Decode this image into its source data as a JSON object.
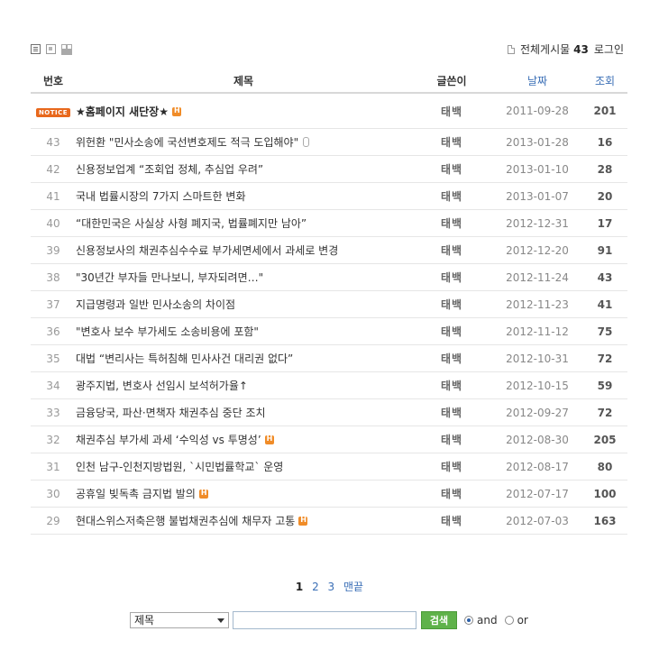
{
  "top": {
    "total_label": "전체게시물",
    "total_count": "43",
    "login": "로그인"
  },
  "headers": {
    "no": "번호",
    "title": "제목",
    "author": "글쓴이",
    "date": "날짜",
    "views": "조회"
  },
  "notice": {
    "badge": "NOTICE",
    "title": "★홈페이지 새단장★",
    "author": "태백",
    "date": "2011-09-28",
    "views": "201"
  },
  "rows": [
    {
      "no": "43",
      "title": "위헌환 \"민사소송에 국선변호제도 적극 도입해야\"",
      "author": "태백",
      "date": "2013-01-28",
      "views": "16"
    },
    {
      "no": "42",
      "title": "신용정보업계 “조회업 정체, 추심업 우려”",
      "author": "태백",
      "date": "2013-01-10",
      "views": "28"
    },
    {
      "no": "41",
      "title": "국내 법률시장의 7가지 스마트한 변화",
      "author": "태백",
      "date": "2013-01-07",
      "views": "20"
    },
    {
      "no": "40",
      "title": "“대한민국은 사실상 사형 폐지국, 법률폐지만 남아”",
      "author": "태백",
      "date": "2012-12-31",
      "views": "17"
    },
    {
      "no": "39",
      "title": "신용정보사의 채권추심수수료 부가세면세에서 과세로 변경",
      "author": "태백",
      "date": "2012-12-20",
      "views": "91"
    },
    {
      "no": "38",
      "title": "\"30년간 부자들 만나보니, 부자되려면…\"",
      "author": "태백",
      "date": "2012-11-24",
      "views": "43"
    },
    {
      "no": "37",
      "title": "지급명령과 일반 민사소송의 차이점",
      "author": "태백",
      "date": "2012-11-23",
      "views": "41"
    },
    {
      "no": "36",
      "title": "\"변호사 보수 부가세도 소송비용에 포함\"",
      "author": "태백",
      "date": "2012-11-12",
      "views": "75"
    },
    {
      "no": "35",
      "title": "대법 “변리사는 특허침해 민사사건 대리권 없다”",
      "author": "태백",
      "date": "2012-10-31",
      "views": "72"
    },
    {
      "no": "34",
      "title": "광주지법, 변호사 선임시 보석허가율↑",
      "author": "태백",
      "date": "2012-10-15",
      "views": "59"
    },
    {
      "no": "33",
      "title": "금융당국, 파산·면책자 채권추심 중단 조치",
      "author": "태백",
      "date": "2012-09-27",
      "views": "72"
    },
    {
      "no": "32",
      "title": "채권추심 부가세 과세 ‘수익성 vs 투명성’",
      "author": "태백",
      "date": "2012-08-30",
      "views": "205"
    },
    {
      "no": "31",
      "title": "인천 남구-인천지방법원, `시민법률학교` 운영",
      "author": "태백",
      "date": "2012-08-17",
      "views": "80"
    },
    {
      "no": "30",
      "title": "공휴일 빚독촉 금지법 발의",
      "author": "태백",
      "date": "2012-07-17",
      "views": "100"
    },
    {
      "no": "29",
      "title": "현대스위스저축은행 불법채권추심에 채무자 고통",
      "author": "태백",
      "date": "2012-07-03",
      "views": "163"
    }
  ],
  "pagination": {
    "current": "1",
    "p2": "2",
    "p3": "3",
    "last": "맨끝"
  },
  "search": {
    "select_value": "제목",
    "button": "검색",
    "and_label": "and",
    "or_label": "or"
  }
}
